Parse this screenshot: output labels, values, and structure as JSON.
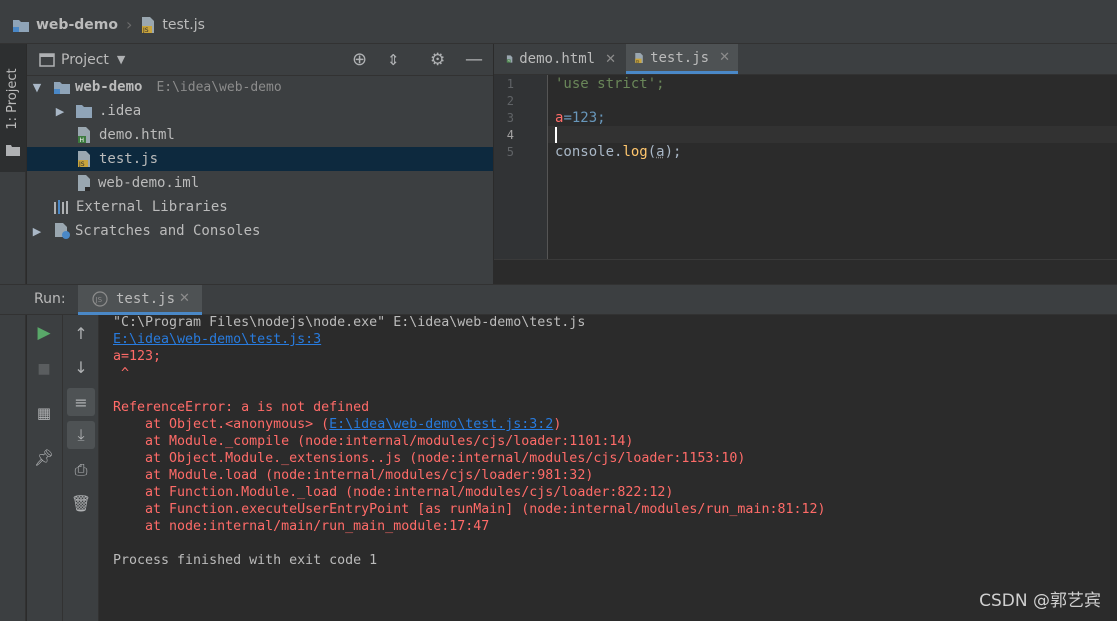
{
  "breadcrumb": {
    "project": "web-demo",
    "file": "test.js"
  },
  "left_tool_window": {
    "label": "1: Project"
  },
  "project_panel": {
    "title": "Project",
    "tree": [
      {
        "name": "web-demo",
        "path": "E:\\idea\\web-demo",
        "type": "module"
      },
      {
        "name": ".idea",
        "type": "folder"
      },
      {
        "name": "demo.html",
        "type": "html"
      },
      {
        "name": "test.js",
        "type": "js",
        "selected": true
      },
      {
        "name": "web-demo.iml",
        "type": "iml"
      },
      {
        "name": "External Libraries",
        "type": "libraries"
      },
      {
        "name": "Scratches and Consoles",
        "type": "scratches"
      }
    ]
  },
  "editor": {
    "tabs": [
      {
        "label": "demo.html",
        "active": false
      },
      {
        "label": "test.js",
        "active": true
      }
    ],
    "line_numbers": [
      "1",
      "2",
      "3",
      "4",
      "5"
    ],
    "current_line": "4",
    "code": {
      "l1": "'use strict';",
      "l3_var": "a",
      "l3_rest": "=123;",
      "l5_obj": "console.",
      "l5_fn": "log",
      "l5_open": "(",
      "l5_arg": "a",
      "l5_close": ");"
    }
  },
  "run_panel": {
    "label": "Run:",
    "tab": "test.js",
    "console": {
      "cmd": "\"C:\\Program Files\\nodejs\\node.exe\" E:\\idea\\web-demo\\test.js",
      "location_link": "E:\\idea\\web-demo\\test.js:3",
      "src_line": "a=123;",
      "caret": " ^",
      "error": "ReferenceError: a is not defined",
      "stack_first_prefix": "    at Object.<anonymous> (",
      "stack_first_link": "E:\\idea\\web-demo\\test.js:3:2",
      "stack_first_suffix": ")",
      "stack": [
        "    at Module._compile (node:internal/modules/cjs/loader:1101:14)",
        "    at Object.Module._extensions..js (node:internal/modules/cjs/loader:1153:10)",
        "    at Module.load (node:internal/modules/cjs/loader:981:32)",
        "    at Function.Module._load (node:internal/modules/cjs/loader:822:12)",
        "    at Function.executeUserEntryPoint [as runMain] (node:internal/modules/run_main:81:12)",
        "    at node:internal/main/run_main_module:17:47"
      ],
      "exit": "Process finished with exit code 1"
    }
  },
  "watermark": "CSDN @郭艺宾",
  "colors": {
    "accent": "#4a88c7",
    "error": "#ff6b68",
    "link": "#287bde",
    "run_green": "#59a869",
    "js_badge": "#c9a43c",
    "html_badge": "#3c7a3e"
  }
}
